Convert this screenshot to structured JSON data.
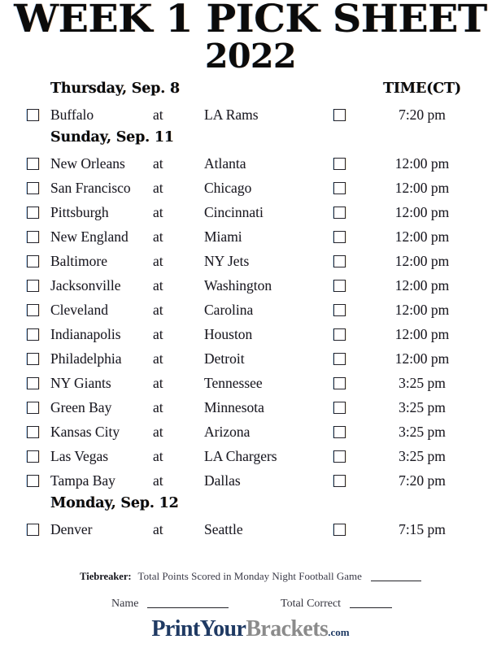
{
  "title": {
    "line1": "WEEK 1 PICK SHEET",
    "line2": "2022"
  },
  "columns": {
    "time_header": "TIME(CT)",
    "at_label": "at"
  },
  "sections": [
    {
      "day_heading": "Thursday, Sep. 8",
      "show_time_header": true,
      "games": [
        {
          "away": "Buffalo",
          "at": "at",
          "home": "LA Rams",
          "time": "7:20 pm"
        }
      ]
    },
    {
      "day_heading": "Sunday, Sep. 11",
      "show_time_header": false,
      "games": [
        {
          "away": "New Orleans",
          "at": "at",
          "home": "Atlanta",
          "time": "12:00 pm"
        },
        {
          "away": "San Francisco",
          "at": "at",
          "home": "Chicago",
          "time": "12:00 pm"
        },
        {
          "away": "Pittsburgh",
          "at": "at",
          "home": "Cincinnati",
          "time": "12:00 pm"
        },
        {
          "away": "New England",
          "at": "at",
          "home": "Miami",
          "time": "12:00 pm"
        },
        {
          "away": "Baltimore",
          "at": "at",
          "home": "NY Jets",
          "time": "12:00 pm"
        },
        {
          "away": "Jacksonville",
          "at": "at",
          "home": "Washington",
          "time": "12:00 pm"
        },
        {
          "away": "Cleveland",
          "at": "at",
          "home": "Carolina",
          "time": "12:00 pm"
        },
        {
          "away": "Indianapolis",
          "at": "at",
          "home": "Houston",
          "time": "12:00 pm"
        },
        {
          "away": "Philadelphia",
          "at": "at",
          "home": "Detroit",
          "time": "12:00 pm"
        },
        {
          "away": "NY Giants",
          "at": "at",
          "home": "Tennessee",
          "time": "3:25 pm"
        },
        {
          "away": "Green Bay",
          "at": "at",
          "home": "Minnesota",
          "time": "3:25 pm"
        },
        {
          "away": "Kansas City",
          "at": "at",
          "home": "Arizona",
          "time": "3:25 pm"
        },
        {
          "away": "Las Vegas",
          "at": "at",
          "home": "LA Chargers",
          "time": "3:25 pm"
        },
        {
          "away": "Tampa Bay",
          "at": "at",
          "home": "Dallas",
          "time": "7:20 pm"
        }
      ]
    },
    {
      "day_heading": "Monday, Sep. 12",
      "show_time_header": false,
      "games": [
        {
          "away": "Denver",
          "at": "at",
          "home": "Seattle",
          "time": "7:15 pm"
        }
      ]
    }
  ],
  "footer": {
    "tiebreaker_label": "Tiebreaker:",
    "tiebreaker_text": "Total Points Scored in Monday Night Football Game",
    "name_label": "Name",
    "total_correct_label": "Total Correct",
    "logo": {
      "part1": "PrintYour",
      "part2": "Brackets",
      "part3": ".com",
      "color1": "#1f3a63",
      "color2": "#8b8b8b"
    }
  }
}
